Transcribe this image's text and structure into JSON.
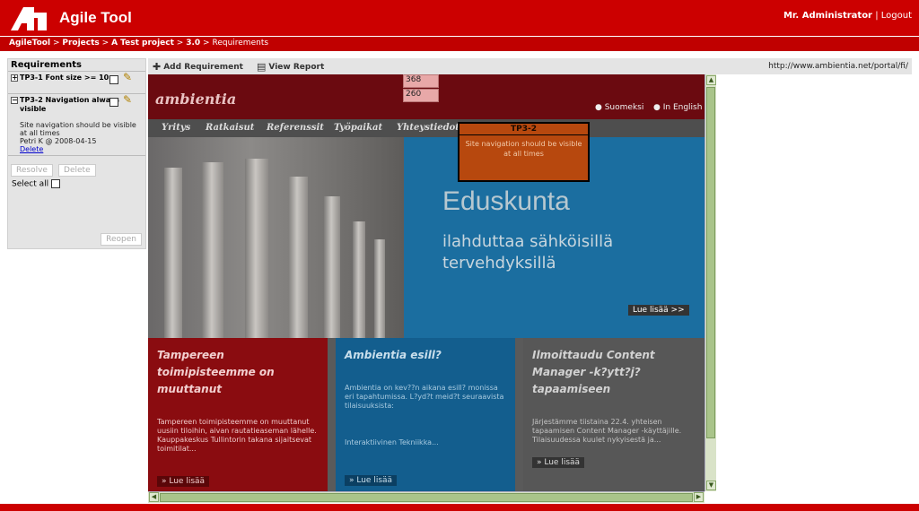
{
  "app": {
    "title": "Agile Tool",
    "user": "Mr. Administrator",
    "separator": "|",
    "logout": "Logout"
  },
  "breadcrumb": {
    "items": [
      "AgileTool",
      "Projects",
      "A Test project",
      "3.0"
    ],
    "current": "Requirements",
    "sep": ">"
  },
  "sidebar": {
    "title": "Requirements",
    "items": [
      {
        "expander": "+",
        "label": "TP3-1 Font size >= 10px"
      },
      {
        "expander": "−",
        "label": "TP3-2 Navigation always visible",
        "description": "Site navigation should be visible at all times",
        "meta": "Petri K @ 2008-04-15",
        "delete_link": "Delete"
      }
    ],
    "resolve": "Resolve",
    "delete": "Delete",
    "select_all": "Select all",
    "reopen": "Reopen"
  },
  "toolbar": {
    "add_requirement": "Add Requirement",
    "view_report": "View Report",
    "url": "http://www.ambientia.net/portal/fi/"
  },
  "site": {
    "logo": "ambientia",
    "lang_fi": "Suomeksi",
    "lang_en": "In English",
    "nav": [
      "Yritys",
      "Ratkaisut",
      "Referenssit",
      "Työpaikat",
      "Yhteystiedot"
    ],
    "hero_title": "Eduskunta",
    "hero_subtitle": "ilahduttaa sähköisillä tervehdyksillä",
    "hero_button": "Lue lisää >>",
    "cards": [
      {
        "title": "Tampereen toimipisteemme on muuttanut",
        "text": "Tampereen toimipisteemme on muuttanut uusiin tiloihin, aivan rautatieaseman lähelle. Kauppakeskus Tullintorin takana sijaitsevat toimitilat...",
        "more": "» Lue lisää"
      },
      {
        "title": "Ambientia esill?",
        "text": "Ambientia on kev??n aikana esill? monissa eri tapahtumissa. L?yd?t meid?t seuraavista tilaisuuksista:",
        "extra": "Interaktiivinen Tekniikka...",
        "more": "» Lue lisää"
      },
      {
        "title": "Ilmoittaudu Content Manager -k?ytt?j?tapaamiseen",
        "text": "Järjestämme tiistaina 22.4. yhteisen tapaamisen Content Manager -käyttäjille. Tilaisuudessa kuulet nykyisestä ja...",
        "more": "» Lue lisää"
      }
    ]
  },
  "overlays": {
    "dim_width": "368",
    "dim_height": "260",
    "note_title": "TP3-2",
    "note_text": "Site navigation should be visible at all times"
  },
  "colors": {
    "brand_red": "#cc0000",
    "site_maroon": "#6b0a10",
    "site_blue": "#1b6ea0",
    "note_orange": "#b7480e"
  }
}
